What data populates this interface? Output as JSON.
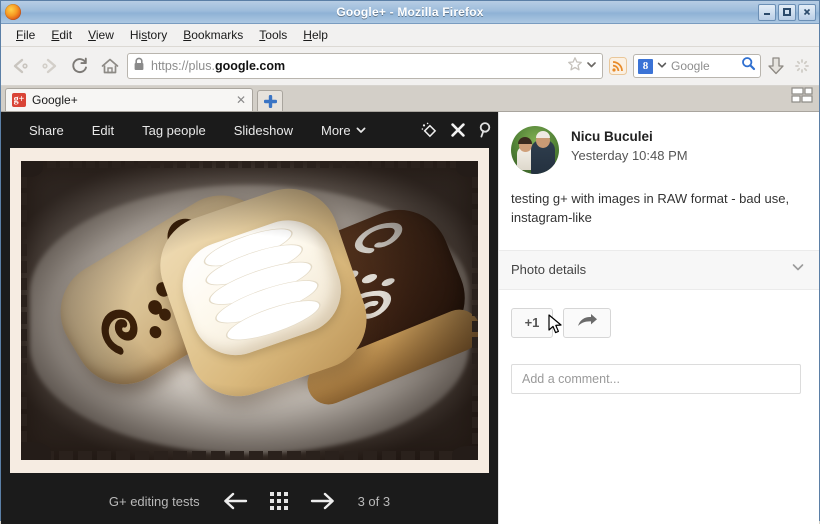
{
  "window": {
    "title": "Google+ - Mozilla Firefox",
    "minimize_label": "Minimize",
    "maximize_label": "Maximize",
    "close_label": "Close"
  },
  "menu": {
    "items": [
      {
        "label": "File",
        "accel": "F"
      },
      {
        "label": "Edit",
        "accel": "E"
      },
      {
        "label": "View",
        "accel": "V"
      },
      {
        "label": "History",
        "accel": "s"
      },
      {
        "label": "Bookmarks",
        "accel": "B"
      },
      {
        "label": "Tools",
        "accel": "T"
      },
      {
        "label": "Help",
        "accel": "H"
      }
    ]
  },
  "navbar": {
    "back_label": "Back",
    "forward_label": "Forward",
    "reload_label": "Reload",
    "home_label": "Home",
    "url_prefix": "https://plus.",
    "url_domain": "google.com",
    "url_full": "https://plus.google.com",
    "lock_icon": "padlock-icon",
    "bookmark_icon": "star-icon",
    "feed_icon": "rss-feed-icon",
    "search_engine": "Google",
    "search_engine_badge": "8",
    "search_placeholder": "Google",
    "search_icon": "magnifier-icon",
    "downloads_icon": "download-arrow-icon",
    "throbber_icon": "loading-spinner-icon"
  },
  "tabs": {
    "items": [
      {
        "label": "Google+",
        "favicon": "google-plus-favicon",
        "favicon_text": "g+",
        "close_label": "✕"
      }
    ],
    "new_tab_label": "+",
    "list_all_tabs_icon": "list-all-tabs-icon"
  },
  "viewer": {
    "toolbar": {
      "items": [
        {
          "label": "Share"
        },
        {
          "label": "Edit"
        },
        {
          "label": "Tag people"
        },
        {
          "label": "Slideshow"
        },
        {
          "label": "More",
          "caret": "⌄"
        }
      ],
      "icons": [
        {
          "name": "auto-enhance-icon"
        },
        {
          "name": "close-icon"
        },
        {
          "name": "zoom-magnifier-icon"
        }
      ]
    },
    "photo": {
      "alt": "Three eclairs on a plate - caramel glazed with chocolate swirls, cream filled, and chocolate glazed with white swirls",
      "style": "instagram-like vintage border"
    },
    "footer": {
      "album": "G+ editing tests",
      "prev_label": "←",
      "grid_label": "grid-view-icon",
      "next_label": "→",
      "counter": "3 of 3"
    }
  },
  "panel": {
    "author": "Nicu Buculei",
    "timestamp": "Yesterday 10:48 PM",
    "avatar_alt": "Profile photo of man holding a child",
    "post_text": "testing g+ with images in RAW format - bad use, instagram-like",
    "details_label": "Photo details",
    "details_chevron": "chevron-down-icon",
    "plusone_label": "+1",
    "share_icon": "share-arrow-icon",
    "comment_placeholder": "Add a comment..."
  },
  "colors": {
    "titlebar_accent": "#9dbcdb",
    "viewer_bg": "#1b1b1b",
    "panel_bg": "#ffffff",
    "google_blue": "#3b73d6",
    "gplus_red": "#d94436"
  }
}
